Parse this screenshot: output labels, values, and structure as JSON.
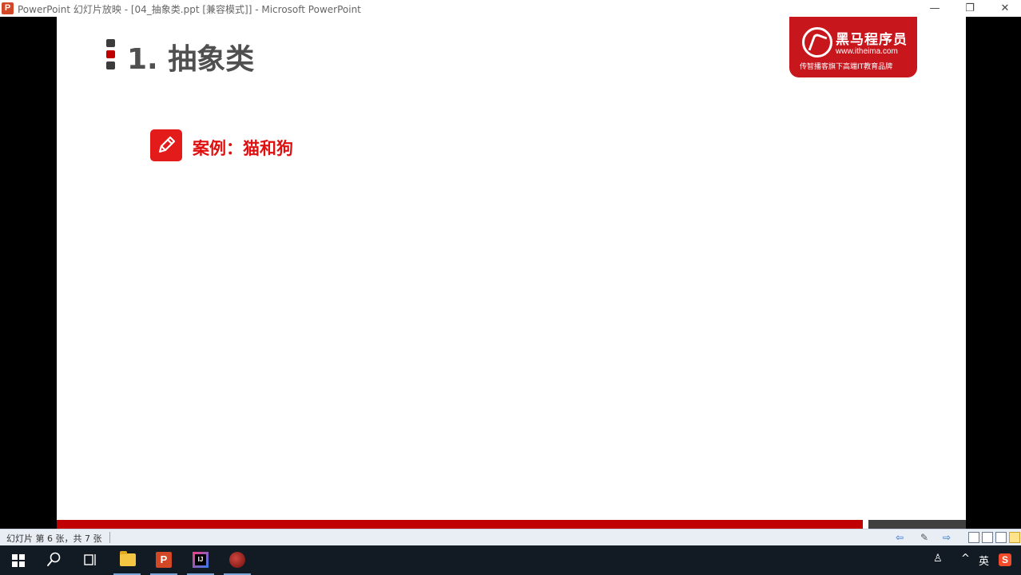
{
  "window": {
    "app_icon_letter": "P",
    "title": "PowerPoint 幻灯片放映 - [04_抽象类.ppt [兼容模式]] - Microsoft PowerPoint",
    "minimize": "—",
    "restore": "❐",
    "close": "✕"
  },
  "slide": {
    "title": "1. 抽象类",
    "case_label": "案例：猫和狗",
    "logo": {
      "name": "黑马程序员",
      "url": "www.itheima.com",
      "tagline": "传智播客旗下高端IT教育品牌"
    },
    "colors": {
      "accent_red": "#c00000",
      "case_red": "#e31b1b",
      "logo_red": "#c8161d"
    }
  },
  "status": {
    "slide_info": "幻灯片 第 6 张，共 7 张",
    "prev_icon": "arrow-left-icon",
    "notes_icon": "notes-icon",
    "next_icon": "arrow-right-icon"
  },
  "taskbar": {
    "items": [
      "start-icon",
      "search-icon",
      "task-view-icon",
      "file-explorer-icon",
      "powerpoint-icon",
      "intellij-idea-icon",
      "screen-recorder-icon"
    ],
    "tray_people": "♙",
    "tray_chevron": "^",
    "ime": "英",
    "sogou": "S"
  }
}
